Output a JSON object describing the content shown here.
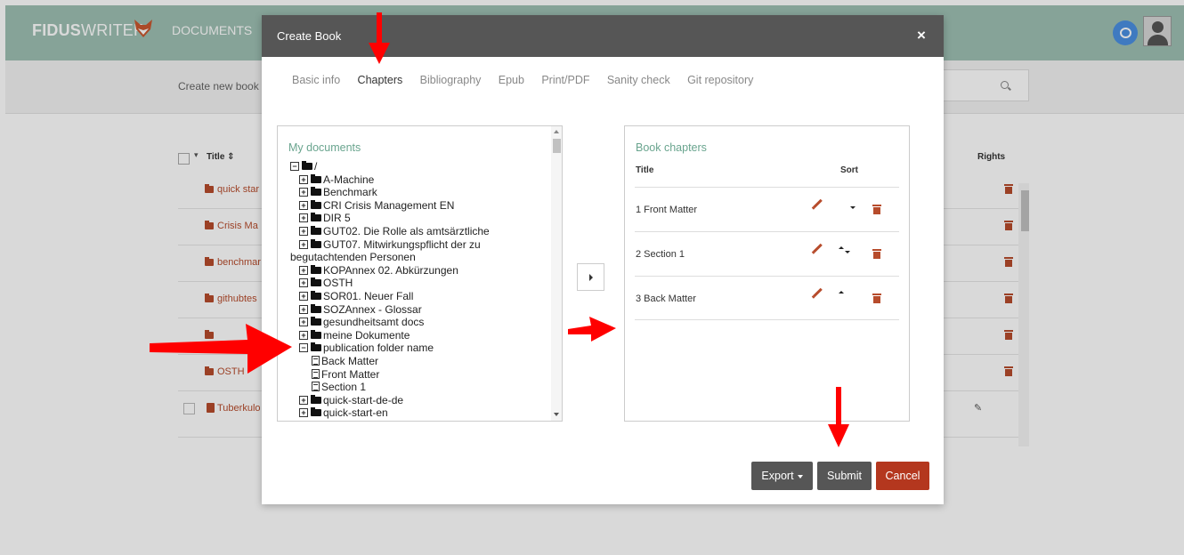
{
  "app": {
    "logo_bold": "FIDUS",
    "logo_light": "WRITER",
    "nav_documents": "DOCUMENTS",
    "create_new_book": "Create new book",
    "table": {
      "col_title": "Title",
      "col_rights": "Rights",
      "rows": [
        {
          "name": "quick star",
          "kind": "folder"
        },
        {
          "name": "Crisis Ma",
          "kind": "folder"
        },
        {
          "name": "benchmar",
          "kind": "folder"
        },
        {
          "name": "githubtes",
          "kind": "folder"
        },
        {
          "name": "",
          "kind": "folder"
        },
        {
          "name": "OSTH",
          "kind": "folder"
        },
        {
          "name": "Tuberkulo",
          "kind": "book"
        }
      ]
    }
  },
  "modal": {
    "title": "Create Book",
    "close_glyph": "×",
    "tabs": [
      {
        "label": "Basic info",
        "active": false
      },
      {
        "label": "Chapters",
        "active": true
      },
      {
        "label": "Bibliography",
        "active": false
      },
      {
        "label": "Epub",
        "active": false
      },
      {
        "label": "Print/PDF",
        "active": false
      },
      {
        "label": "Sanity check",
        "active": false
      },
      {
        "label": "Git repository",
        "active": false
      }
    ],
    "my_documents": {
      "title": "My documents",
      "tree": [
        {
          "label": "/",
          "type": "folder",
          "expanded": true,
          "level": 0
        },
        {
          "label": "A-Machine",
          "type": "folder",
          "expanded": false,
          "level": 1
        },
        {
          "label": "Benchmark",
          "type": "folder",
          "expanded": false,
          "level": 1
        },
        {
          "label": "CRI Crisis Management EN",
          "type": "folder",
          "expanded": false,
          "level": 1
        },
        {
          "label": "DIR 5",
          "type": "folder",
          "expanded": false,
          "level": 1
        },
        {
          "label": "GUT02. Die Rolle als amtsärztliche",
          "type": "folder",
          "expanded": false,
          "level": 1
        },
        {
          "label": "GUT07. Mitwirkungspflicht der zu begutachtenden Personen",
          "type": "folder",
          "expanded": false,
          "level": 1,
          "wrap": true
        },
        {
          "label": "KOPAnnex 02. Abkürzungen",
          "type": "folder",
          "expanded": false,
          "level": 1
        },
        {
          "label": "OSTH",
          "type": "folder",
          "expanded": false,
          "level": 1
        },
        {
          "label": "SOR01. Neuer Fall",
          "type": "folder",
          "expanded": false,
          "level": 1
        },
        {
          "label": "SOZAnnex - Glossar",
          "type": "folder",
          "expanded": false,
          "level": 1
        },
        {
          "label": "gesundheitsamt docs",
          "type": "folder",
          "expanded": false,
          "level": 1
        },
        {
          "label": "meine Dokumente",
          "type": "folder",
          "expanded": false,
          "level": 1
        },
        {
          "label": "publication folder name",
          "type": "folder",
          "expanded": true,
          "level": 1
        },
        {
          "label": "Back Matter",
          "type": "doc",
          "level": 2
        },
        {
          "label": "Front Matter",
          "type": "doc",
          "level": 2
        },
        {
          "label": "Section 1",
          "type": "doc",
          "level": 2
        },
        {
          "label": "quick-start-de-de",
          "type": "folder",
          "expanded": false,
          "level": 1
        },
        {
          "label": "quick-start-en",
          "type": "folder",
          "expanded": false,
          "level": 1
        }
      ]
    },
    "book_chapters": {
      "title": "Book chapters",
      "col_title": "Title",
      "col_sort": "Sort",
      "chapters": [
        {
          "label": "1 Front Matter",
          "can_up": false,
          "can_down": true
        },
        {
          "label": "2 Section 1",
          "can_up": true,
          "can_down": true
        },
        {
          "label": "3 Back Matter",
          "can_up": true,
          "can_down": false
        }
      ]
    },
    "buttons": {
      "export": "Export",
      "submit": "Submit",
      "cancel": "Cancel"
    }
  },
  "colors": {
    "topbar": "#9ec0b3",
    "modal_header": "#565656",
    "accent_green": "#6aa58f",
    "danger": "#b4371e",
    "annotation_arrow": "#ff0000"
  }
}
